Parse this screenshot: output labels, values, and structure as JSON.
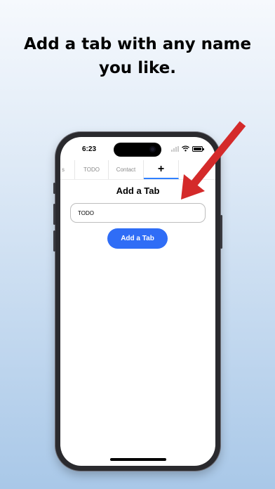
{
  "headline": {
    "line1": "Add a tab with any name",
    "line2": "you like."
  },
  "status_bar": {
    "time": "6:23"
  },
  "tabs": [
    {
      "label": "s"
    },
    {
      "label": "TODO"
    },
    {
      "label": "Contact"
    },
    {
      "label": "+"
    }
  ],
  "page": {
    "title": "Add a Tab"
  },
  "form": {
    "tab_name_value": "TODO",
    "submit_label": "Add a Tab"
  },
  "icons": {
    "add_tab": "plus-icon",
    "settings": "gear-icon",
    "wifi": "wifi-icon",
    "battery": "battery-icon",
    "signal": "cellular-signal-icon"
  },
  "colors": {
    "accent": "#2f6df6",
    "tab_indicator": "#2f80ff",
    "arrow": "#d42a2a",
    "background_top": "#f6f9fd",
    "background_bottom": "#a9c8e8"
  }
}
